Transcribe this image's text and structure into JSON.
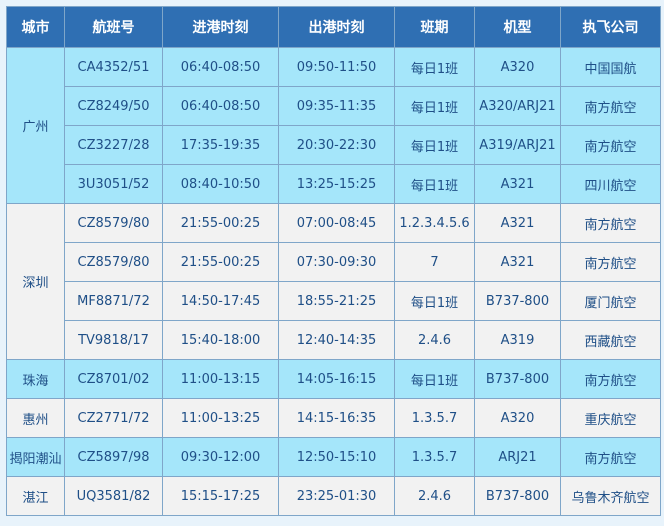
{
  "headers": [
    "城市",
    "航班号",
    "进港时刻",
    "出港时刻",
    "班期",
    "机型",
    "执飞公司"
  ],
  "groups": [
    {
      "city": "广州",
      "band": "a",
      "rows": [
        [
          "CA4352/51",
          "06:40-08:50",
          "09:50-11:50",
          "每日1班",
          "A320",
          "中国国航"
        ],
        [
          "CZ8249/50",
          "06:40-08:50",
          "09:35-11:35",
          "每日1班",
          "A320/ARJ21",
          "南方航空"
        ],
        [
          "CZ3227/28",
          "17:35-19:35",
          "20:30-22:30",
          "每日1班",
          "A319/ARJ21",
          "南方航空"
        ],
        [
          "3U3051/52",
          "08:40-10:50",
          "13:25-15:25",
          "每日1班",
          "A321",
          "四川航空"
        ]
      ]
    },
    {
      "city": "深圳",
      "band": "b",
      "rows": [
        [
          "CZ8579/80",
          "21:55-00:25",
          "07:00-08:45",
          "1.2.3.4.5.6",
          "A321",
          "南方航空"
        ],
        [
          "CZ8579/80",
          "21:55-00:25",
          "07:30-09:30",
          "7",
          "A321",
          "南方航空"
        ],
        [
          "MF8871/72",
          "14:50-17:45",
          "18:55-21:25",
          "每日1班",
          "B737-800",
          "厦门航空"
        ],
        [
          "TV9818/17",
          "15:40-18:00",
          "12:40-14:35",
          "2.4.6",
          "A319",
          "西藏航空"
        ]
      ]
    },
    {
      "city": "珠海",
      "band": "a",
      "rows": [
        [
          "CZ8701/02",
          "11:00-13:15",
          "14:05-16:15",
          "每日1班",
          "B737-800",
          "南方航空"
        ]
      ]
    },
    {
      "city": "惠州",
      "band": "b",
      "rows": [
        [
          "CZ2771/72",
          "11:00-13:25",
          "14:15-16:35",
          "1.3.5.7",
          "A320",
          "重庆航空"
        ]
      ]
    },
    {
      "city": "揭阳潮汕",
      "band": "a",
      "rows": [
        [
          "CZ5897/98",
          "09:30-12:00",
          "12:50-15:10",
          "1.3.5.7",
          "ARJ21",
          "南方航空"
        ]
      ]
    },
    {
      "city": "湛江",
      "band": "b",
      "rows": [
        [
          "UQ3581/82",
          "15:15-17:25",
          "23:25-01:30",
          "2.4.6",
          "B737-800",
          "乌鲁木齐航空"
        ]
      ]
    }
  ],
  "colors": {
    "header_bg": "#2f6fb3",
    "header_text": "#ffffff",
    "band_a": "#a5e6fa",
    "band_b": "#f2f2f2",
    "cell_text": "#1f4f87",
    "border": "#7fa6c9"
  }
}
